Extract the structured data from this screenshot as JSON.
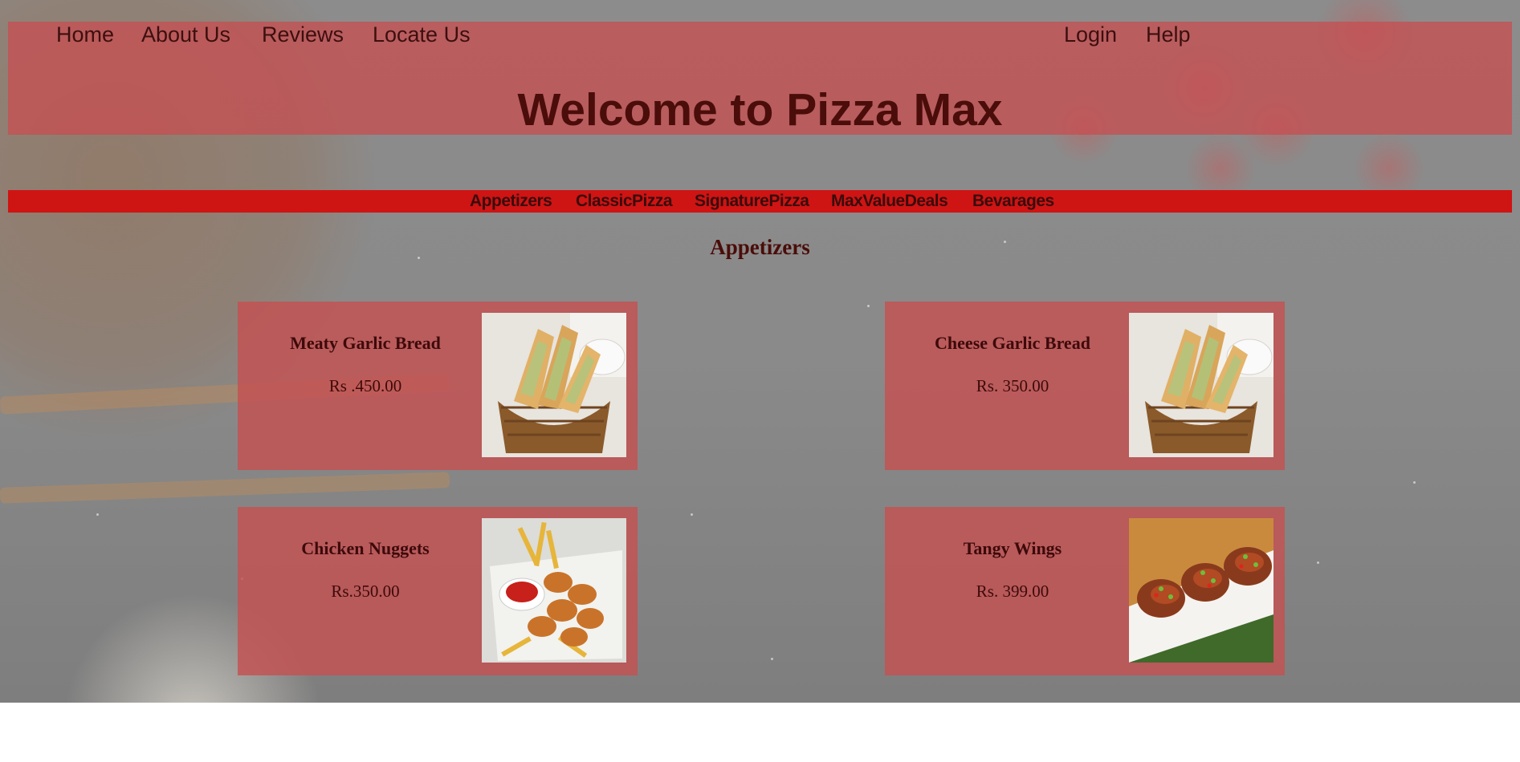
{
  "nav": {
    "left": [
      "Home",
      "About Us",
      "Reviews",
      "Locate Us"
    ],
    "right": [
      "Login",
      "Help"
    ]
  },
  "site_title": "Welcome to Pizza Max",
  "categories": [
    "Appetizers",
    "ClassicPizza",
    "SignaturePizza",
    "MaxValueDeals",
    "Bevarages"
  ],
  "section_title": "Appetizers",
  "items": [
    {
      "name": "Meaty Garlic Bread",
      "price": "Rs .450.00",
      "image": "garlic-bread-basket-photo"
    },
    {
      "name": "Cheese Garlic Bread",
      "price": "Rs. 350.00",
      "image": "garlic-bread-basket-photo"
    },
    {
      "name": "Chicken Nuggets",
      "price": "Rs.350.00",
      "image": "chicken-nuggets-photo"
    },
    {
      "name": "Tangy Wings",
      "price": "Rs. 399.00",
      "image": "tangy-wings-photo"
    }
  ],
  "colors": {
    "header_overlay": "#c55052",
    "category_bar": "#cf1414",
    "text_dark": "#4a0d0a"
  }
}
